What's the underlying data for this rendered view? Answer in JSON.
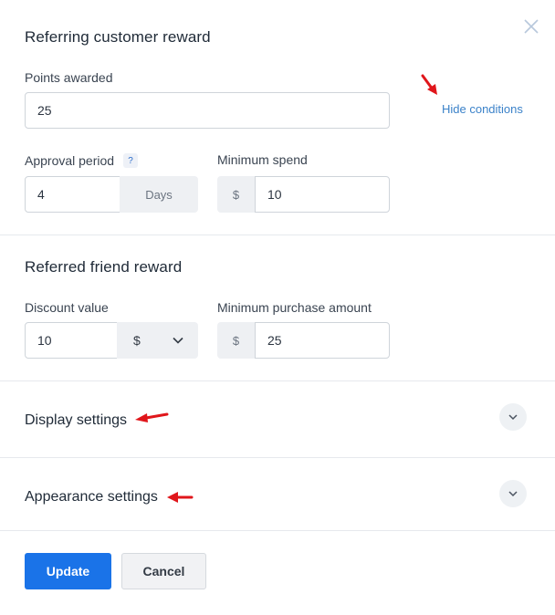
{
  "referring": {
    "title": "Referring customer reward",
    "points_label": "Points awarded",
    "points_value": "25",
    "hide_conditions_link": "Hide conditions",
    "approval_label": "Approval period",
    "help_glyph": "?",
    "approval_value": "4",
    "approval_unit": "Days",
    "min_spend_label": "Minimum spend",
    "min_spend_currency": "$",
    "min_spend_value": "10"
  },
  "referred": {
    "title": "Referred friend reward",
    "discount_label": "Discount value",
    "discount_value": "10",
    "discount_type_selected": "$",
    "min_purchase_label": "Minimum purchase amount",
    "min_purchase_currency": "$",
    "min_purchase_value": "25"
  },
  "sections": {
    "display_settings": "Display settings",
    "appearance_settings": "Appearance settings"
  },
  "actions": {
    "update": "Update",
    "cancel": "Cancel"
  },
  "icons": {
    "close": "close-icon",
    "chevron": "chevron-down-icon",
    "annotation_arrow": "red-arrow-icon"
  },
  "colors": {
    "primary": "#1a73e8",
    "link": "#3b82c9",
    "annotation": "#e0161b"
  }
}
